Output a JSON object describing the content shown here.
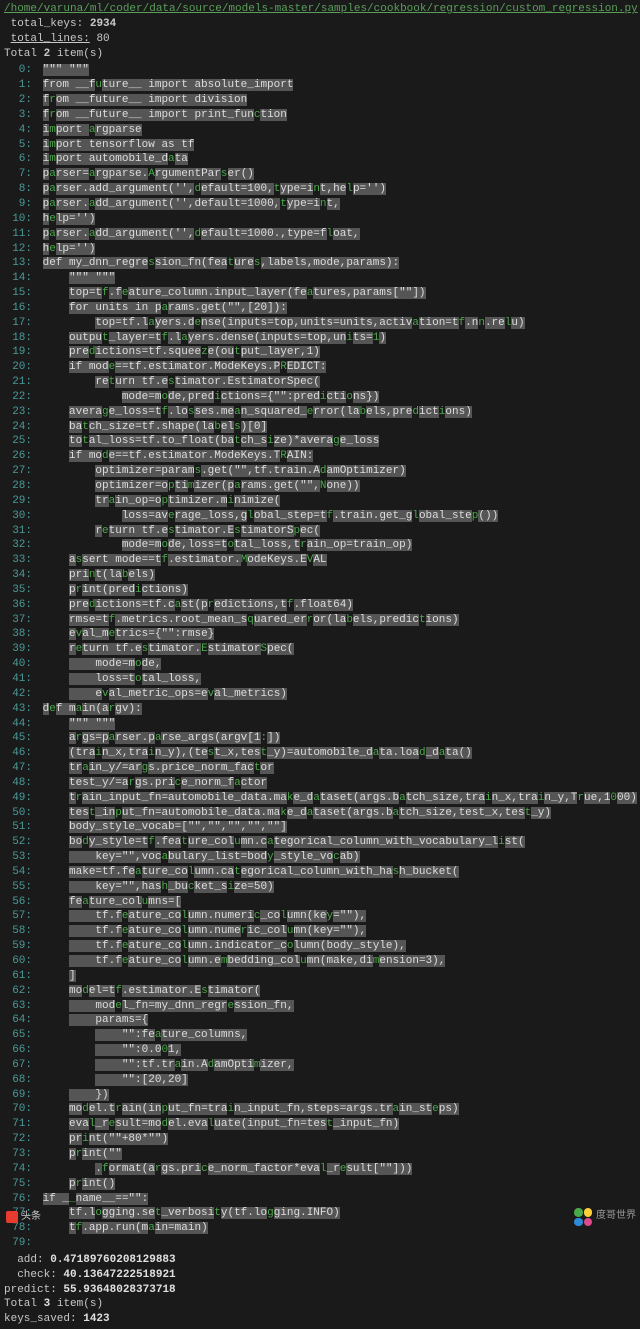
{
  "header": {
    "path": "/home/varuna/ml/coder/data/source/models-master/samples/cookbook/regression/custom_regression.py",
    "total_keys_label": "total_keys:",
    "total_keys": "2934",
    "total_lines_label": "total_lines:",
    "total_lines": "80",
    "items_prefix": "Total",
    "items_count": "2",
    "items_suffix": "item(s)"
  },
  "code": {
    "0": "\"\"\" \"\"\"",
    "1": "from __future__ import absolute_import",
    "2": "from __future__ import division",
    "3": "from __future__ import print_function",
    "4": "import argparse",
    "5": "import tensorflow as tf",
    "6": "import automobile_data",
    "7": "parser=argparse.ArgumentParser()",
    "8": "parser.add_argument('',default=100,type=int,help='')",
    "9": "parser.add_argument('',default=1000,type=int,",
    "10": "help='')",
    "11": "parser.add_argument('',default=1000.,type=float,",
    "12": "help='')",
    "13": "def my_dnn_regression_fn(features,labels,mode,params):",
    "14": "    \"\"\" \"\"\"",
    "15": "    top=tf.feature_column.input_layer(features,params[\"\"])",
    "16": "    for units in params.get(\"\",[20]):",
    "17": "        top=tf.layers.dense(inputs=top,units=units,activation=tf.nn.relu)",
    "18": "    output_layer=tf.layers.dense(inputs=top,units=1)",
    "19": "    predictions=tf.squeeze(output_layer,1)",
    "20": "    if mode==tf.estimator.ModeKeys.PREDICT:",
    "21": "        return tf.estimator.EstimatorSpec(",
    "22": "            mode=mode,predictions={\"\":predictions})",
    "23": "    average_loss=tf.losses.mean_squared_error(labels,predictions)",
    "24": "    batch_size=tf.shape(labels)[0]",
    "25": "    total_loss=tf.to_float(batch_size)*average_loss",
    "26": "    if mode==tf.estimator.ModeKeys.TRAIN:",
    "27": "        optimizer=params.get(\"\",tf.train.AdamOptimizer)",
    "28": "        optimizer=optimizer(params.get(\"\",None))",
    "29": "        train_op=optimizer.minimize(",
    "30": "            loss=average_loss,global_step=tf.train.get_global_step())",
    "31": "        return tf.estimator.EstimatorSpec(",
    "32": "            mode=mode,loss=total_loss,train_op=train_op)",
    "33": "    assert mode==tf.estimator.ModeKeys.EVAL",
    "34": "    print(labels)",
    "35": "    print(predictions)",
    "36": "    predictions=tf.cast(predictions,tf.float64)",
    "37": "    rmse=tf.metrics.root_mean_squared_error(labels,predictions)",
    "38": "    eval_metrics={\"\":rmse}",
    "39": "    return tf.estimator.EstimatorSpec(",
    "40": "        mode=mode,",
    "41": "        loss=total_loss,",
    "42": "        eval_metric_ops=eval_metrics)",
    "43": "def main(argv):",
    "44": "    \"\"\" \"\"\"",
    "45": "    args=parser.parse_args(argv[1:])",
    "46": "    (train_x,train_y),(test_x,test_y)=automobile_data.load_data()",
    "47": "    train_y/=args.price_norm_factor",
    "48": "    test_y/=args.price_norm_factor",
    "49": "    train_input_fn=automobile_data.make_dataset(args.batch_size,train_x,train_y,True,1000)",
    "50": "    test_input_fn=automobile_data.make_dataset(args.batch_size,test_x,test_y)",
    "51": "    body_style_vocab=[\"\",\"\",\"\",\"\",\"\"]",
    "52": "    body_style=tf.feature_column.categorical_column_with_vocabulary_list(",
    "53": "        key=\"\",vocabulary_list=body_style_vocab)",
    "54": "    make=tf.feature_column.categorical_column_with_hash_bucket(",
    "55": "        key=\"\",hash_bucket_size=50)",
    "56": "    feature_columns=[",
    "57": "        tf.feature_column.numeric_column(key=\"\"),",
    "58": "        tf.feature_column.numeric_column(key=\"\"),",
    "59": "        tf.feature_column.indicator_column(body_style),",
    "60": "        tf.feature_column.embedding_column(make,dimension=3),",
    "61": "    ]",
    "62": "    model=tf.estimator.Estimator(",
    "63": "        model_fn=my_dnn_regression_fn,",
    "64": "        params={",
    "65": "            \"\":feature_columns,",
    "66": "            \"\":0.001,",
    "67": "            \"\":tf.train.AdamOptimizer,",
    "68": "            \"\":[20,20]",
    "69": "        })",
    "70": "    model.train(input_fn=train_input_fn,steps=args.train_steps)",
    "71": "    eval_result=model.evaluate(input_fn=test_input_fn)",
    "72": "    print(\"\"+80*\"\")",
    "73": "    print(\"\"",
    "74": "        .format(args.price_norm_factor*eval_result[\"\"]))",
    "75": "    print()",
    "76": "if __name__==\"\":",
    "77": "    tf.logging.set_verbosity(tf.logging.INFO)",
    "78": "    tf.app.run(main=main)",
    "79": ""
  },
  "footer": {
    "add_label": "add:",
    "add": "0.47189760208129883",
    "check_label": "check:",
    "check": "40.13647222518921",
    "predict_label": "predict:",
    "predict": "55.93648028373718",
    "items_prefix": "Total",
    "items_count": "3",
    "items_suffix": "item(s)",
    "keys_saved_label": "keys_saved:",
    "keys_saved": "1423"
  },
  "watermark": {
    "toutiao": "头条",
    "right": "度哥世界"
  }
}
